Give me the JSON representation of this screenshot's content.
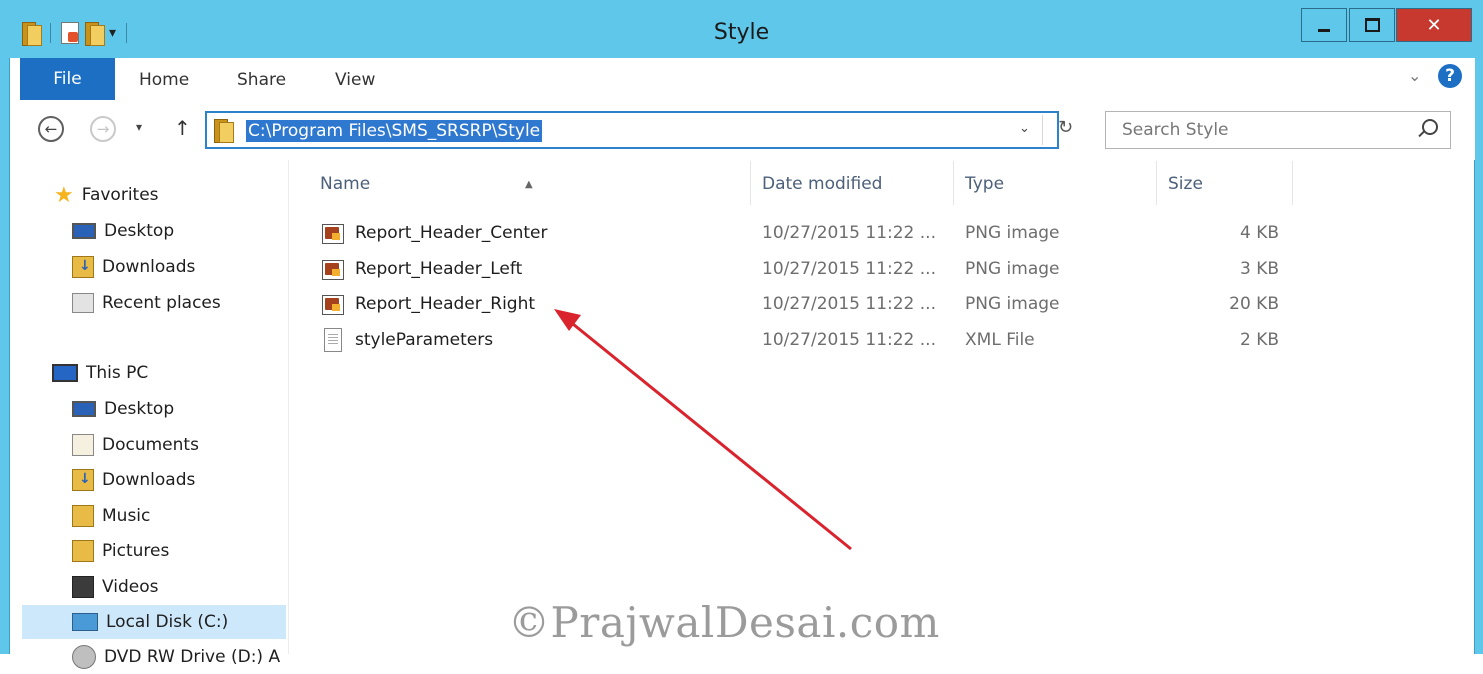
{
  "window": {
    "title": "Style",
    "close_glyph": "✕"
  },
  "ribbon": {
    "tabs": [
      "File",
      "Home",
      "Share",
      "View"
    ],
    "help_glyph": "?"
  },
  "nav": {
    "back_glyph": "←",
    "forward_glyph": "→",
    "recent_glyph": "▾",
    "up_glyph": "↑",
    "address": "C:\\Program Files\\SMS_SRSRP\\Style",
    "address_dropdown_glyph": "⌄",
    "refresh_glyph": "↻",
    "search_placeholder": "Search Style"
  },
  "navpane": {
    "items": [
      {
        "label": "Favorites",
        "icon": "star-icon"
      },
      {
        "label": "Desktop",
        "icon": "desktop-icon"
      },
      {
        "label": "Downloads",
        "icon": "downloads-icon"
      },
      {
        "label": "Recent places",
        "icon": "recent-places-icon"
      },
      {
        "label": "This PC",
        "icon": "computer-icon"
      },
      {
        "label": "Desktop",
        "icon": "desktop-icon"
      },
      {
        "label": "Documents",
        "icon": "documents-icon"
      },
      {
        "label": "Downloads",
        "icon": "downloads-icon"
      },
      {
        "label": "Music",
        "icon": "music-icon"
      },
      {
        "label": "Pictures",
        "icon": "pictures-icon"
      },
      {
        "label": "Videos",
        "icon": "videos-icon"
      },
      {
        "label": "Local Disk (C:)",
        "icon": "disk-icon",
        "selected": true
      },
      {
        "label": "DVD RW Drive (D:) A",
        "icon": "dvd-icon"
      }
    ]
  },
  "files": {
    "columns": [
      "Name",
      "Date modified",
      "Type",
      "Size"
    ],
    "sort_glyph": "▲",
    "rows": [
      {
        "name": "Report_Header_Center",
        "date": "10/27/2015 11:22 ...",
        "type": "PNG image",
        "size": "4 KB",
        "icon": "png-file-icon"
      },
      {
        "name": "Report_Header_Left",
        "date": "10/27/2015 11:22 ...",
        "type": "PNG image",
        "size": "3 KB",
        "icon": "png-file-icon"
      },
      {
        "name": "Report_Header_Right",
        "date": "10/27/2015 11:22 ...",
        "type": "PNG image",
        "size": "20 KB",
        "icon": "png-file-icon"
      },
      {
        "name": "styleParameters",
        "date": "10/27/2015 11:22 ...",
        "type": "XML File",
        "size": "2 KB",
        "icon": "xml-file-icon"
      }
    ]
  },
  "watermark": "©PrajwalDesai.com",
  "colors": {
    "title_bar": "#5fc7ea",
    "file_tab": "#1d6fc4",
    "close_button": "#c7392e",
    "address_highlight": "#2f78d0",
    "selected_nav": "#cde8fb",
    "annotation_arrow": "#d9232d"
  }
}
